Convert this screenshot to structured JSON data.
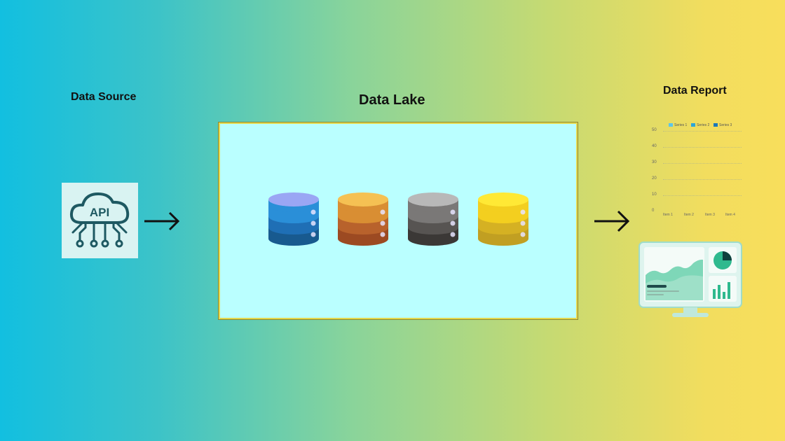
{
  "source": {
    "title": "Data Source",
    "api_label": "API"
  },
  "lake": {
    "title": "Data Lake",
    "databases": [
      {
        "name": "blue-database",
        "colors": [
          "#9aa6f4",
          "#2a8fd8",
          "#1f6fb5",
          "#185a8f"
        ]
      },
      {
        "name": "orange-database",
        "colors": [
          "#f5c153",
          "#d98e33",
          "#b8622c",
          "#9c4a22"
        ]
      },
      {
        "name": "gray-database",
        "colors": [
          "#b8b8b8",
          "#7a7877",
          "#575452",
          "#3b3836"
        ]
      },
      {
        "name": "yellow-database",
        "colors": [
          "#ffe935",
          "#f3cf1f",
          "#d5b123",
          "#c19f22"
        ]
      }
    ]
  },
  "report": {
    "title": "Data Report",
    "chart": {
      "legend": [
        "Series 1",
        "Series 2",
        "Series 3"
      ],
      "legend_colors": [
        "#5ec6e8",
        "#2da6d8",
        "#1c78b8"
      ],
      "y_ticks": [
        "50",
        "40",
        "30",
        "20",
        "10",
        "0"
      ],
      "x_ticks": [
        "Item 1",
        "Item 2",
        "Item 3",
        "Item 4"
      ]
    }
  }
}
